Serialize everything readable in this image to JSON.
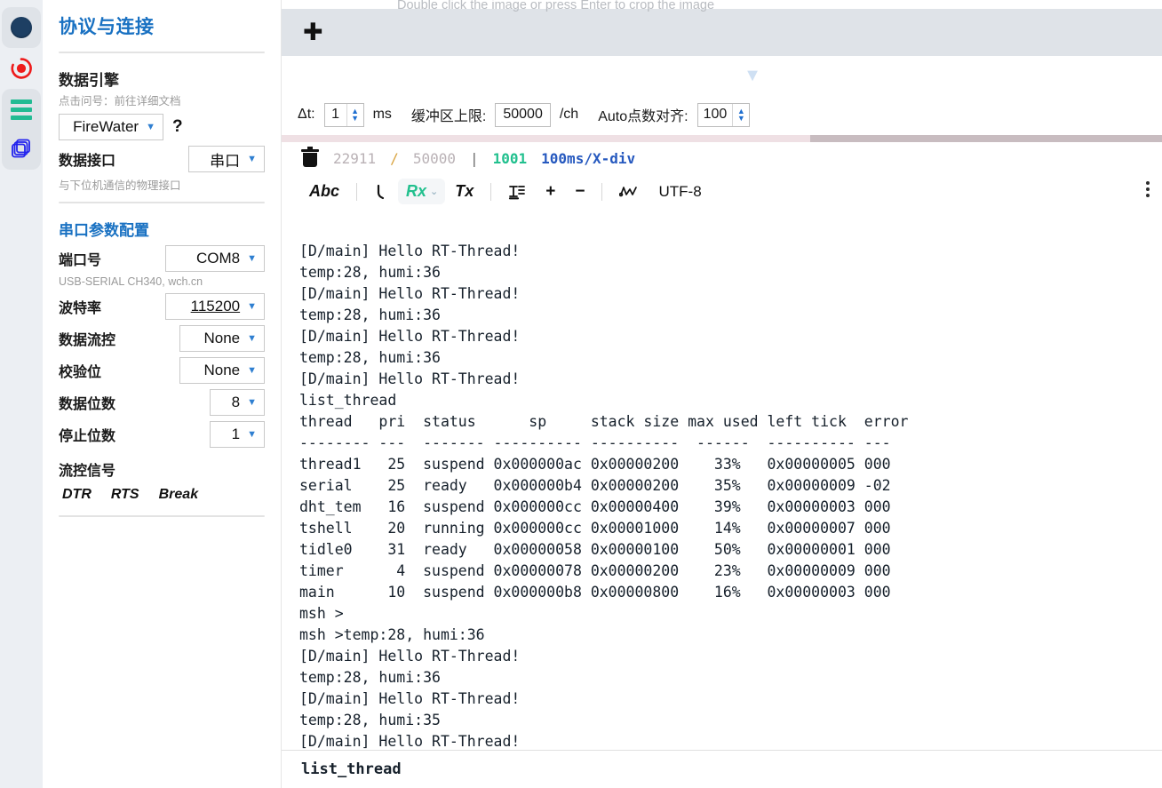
{
  "rail": {
    "items": [
      {
        "name": "record-dot",
        "label": "连接状态"
      },
      {
        "name": "record-target",
        "label": "录制"
      },
      {
        "name": "menu-lines",
        "label": "菜单"
      },
      {
        "name": "layers",
        "label": "图层"
      }
    ]
  },
  "sidebar": {
    "title": "协议与连接",
    "engine": {
      "heading": "数据引擎",
      "hint": "点击问号：前往详细文档",
      "value": "FireWater",
      "help": "?"
    },
    "interface": {
      "label": "数据接口",
      "value": "串口",
      "hint": "与下位机通信的物理接口"
    },
    "serial": {
      "heading": "串口参数配置",
      "port": {
        "label": "端口号",
        "value": "COM8",
        "hint": "USB-SERIAL CH340, wch.cn"
      },
      "baud": {
        "label": "波特率",
        "value": "115200"
      },
      "flow": {
        "label": "数据流控",
        "value": "None"
      },
      "parity": {
        "label": "校验位",
        "value": "None"
      },
      "databits": {
        "label": "数据位数",
        "value": "8"
      },
      "stopbits": {
        "label": "停止位数",
        "value": "1"
      },
      "signals_label": "流控信号",
      "signals": [
        "DTR",
        "RTS",
        "Break"
      ]
    }
  },
  "main": {
    "crop_hint": "Double click the image or press Enter to crop the image",
    "tab_add": "✛",
    "params": {
      "dt_label": "Δt:",
      "dt_value": "1",
      "dt_unit": "ms",
      "buffer_label": "缓冲区上限:",
      "buffer_value": "50000",
      "buffer_unit": "/ch",
      "auto_label": "Auto点数对齐:",
      "auto_value": "100"
    },
    "status": {
      "used": "22911",
      "slash": "/",
      "total": "50000",
      "pipe": "|",
      "rate": "1001",
      "timebase": "100ms/X-div"
    },
    "toolbar": {
      "abc": "Abc",
      "wrap": "↳",
      "rx": "Rx",
      "rx_caret": "⌄",
      "tx": "Tx",
      "text_icon": "T",
      "plus": "+",
      "minus": "−",
      "wave": "∿",
      "encoding": "UTF-8"
    },
    "terminal_lines": [
      "[D/main] Hello RT-Thread!",
      "temp:28, humi:36",
      "[D/main] Hello RT-Thread!",
      "temp:28, humi:36",
      "[D/main] Hello RT-Thread!",
      "temp:28, humi:36",
      "[D/main] Hello RT-Thread!",
      "list_thread",
      "thread   pri  status      sp     stack size max used left tick  error",
      "-------- ---  ------- ---------- ----------  ------  ---------- ---",
      "thread1   25  suspend 0x000000ac 0x00000200    33%   0x00000005 000",
      "serial    25  ready   0x000000b4 0x00000200    35%   0x00000009 -02",
      "dht_tem   16  suspend 0x000000cc 0x00000400    39%   0x00000003 000",
      "tshell    20  running 0x000000cc 0x00001000    14%   0x00000007 000",
      "tidle0    31  ready   0x00000058 0x00000100    50%   0x00000001 000",
      "timer      4  suspend 0x00000078 0x00000200    23%   0x00000009 000",
      "main      10  suspend 0x000000b8 0x00000800    16%   0x00000003 000",
      "msh >",
      "msh >temp:28, humi:36",
      "[D/main] Hello RT-Thread!",
      "temp:28, humi:36",
      "[D/main] Hello RT-Thread!",
      "temp:28, humi:35",
      "[D/main] Hello RT-Thread!"
    ],
    "command_input": "list_thread"
  },
  "colors": {
    "accent_blue": "#1971c2",
    "green": "#21c08e",
    "red": "#ee1b1b",
    "status_blue": "#2659bf",
    "rail_bg": "#eceff3"
  }
}
